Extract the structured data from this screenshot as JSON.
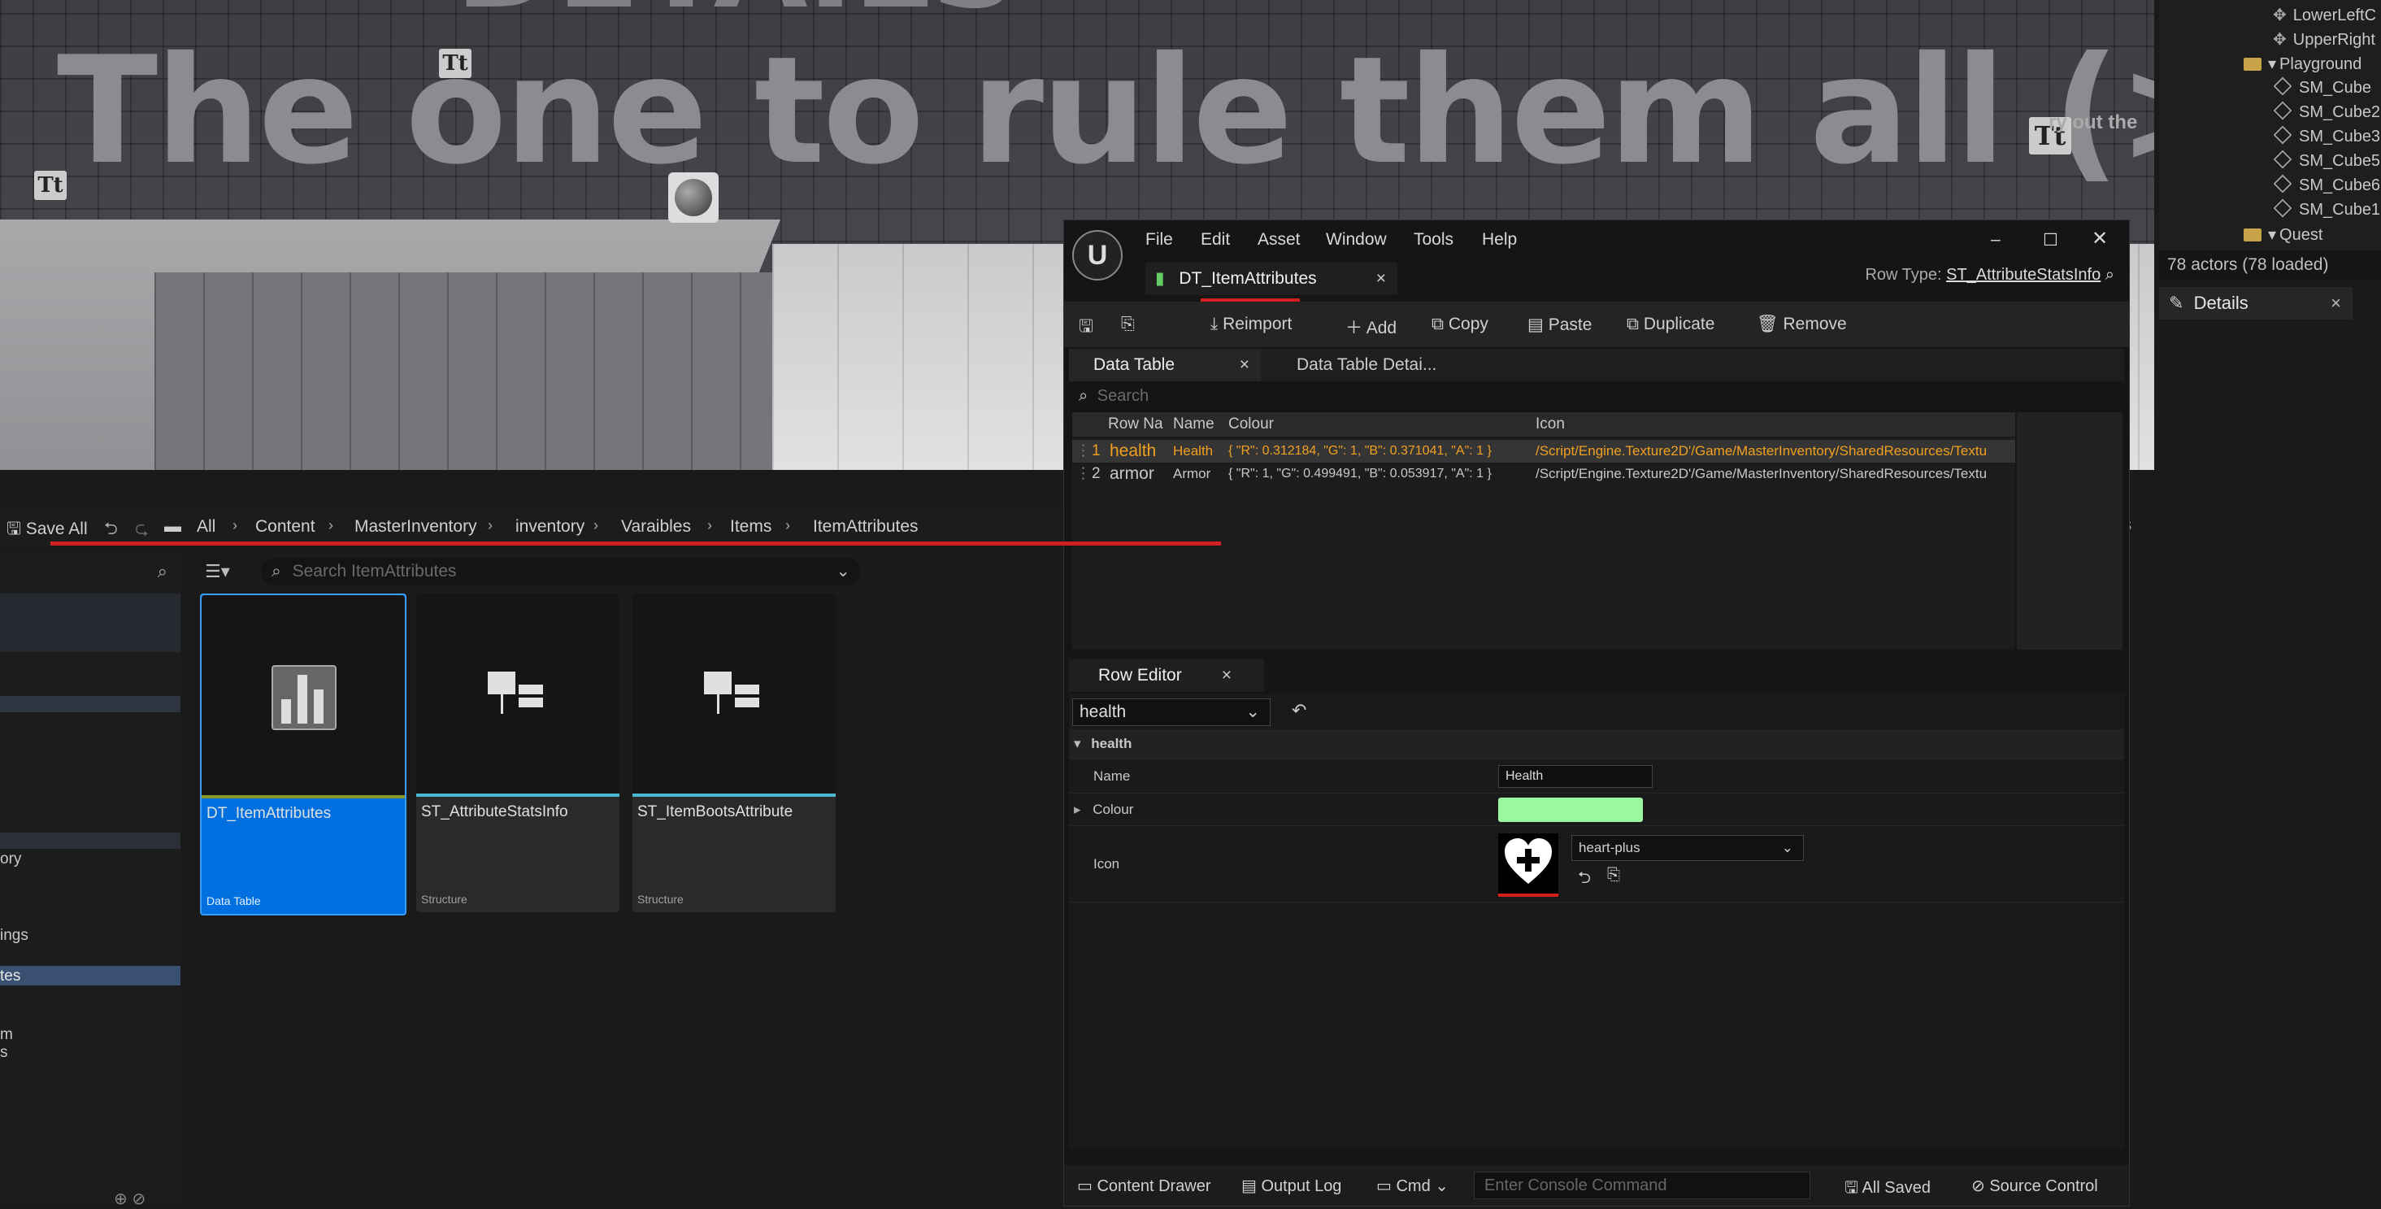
{
  "viewport": {
    "banner": "The one to rule them all (>-<)",
    "banner_top": "DETAILS",
    "tryout": "ry out the",
    "tt_label": "Tt"
  },
  "outliner": {
    "items": [
      {
        "label": "LowerLeftC",
        "kind": "cross"
      },
      {
        "label": "UpperRight",
        "kind": "cross"
      },
      {
        "label": "Playground",
        "kind": "folder"
      },
      {
        "label": "SM_Cube",
        "kind": "cube"
      },
      {
        "label": "SM_Cube2",
        "kind": "cube"
      },
      {
        "label": "SM_Cube3",
        "kind": "cube"
      },
      {
        "label": "SM_Cube5",
        "kind": "cube"
      },
      {
        "label": "SM_Cube6",
        "kind": "cube"
      },
      {
        "label": "SM_Cube1",
        "kind": "cube"
      },
      {
        "label": "Quest",
        "kind": "folder"
      }
    ],
    "actor_count": "78 actors (78 loaded)",
    "details_tab": "Details"
  },
  "content_browser": {
    "save_all": "Save All",
    "breadcrumbs": [
      "All",
      "Content",
      "MasterInventory",
      "inventory",
      "Varaibles",
      "Items",
      "ItemAttributes"
    ],
    "search_placeholder": "Search ItemAttributes",
    "tree_fragments": [
      "ory",
      "ings",
      "tes",
      "m",
      "s"
    ],
    "settings_fragment": "gs",
    "assets": [
      {
        "name": "DT_ItemAttributes",
        "type": "Data Table",
        "selected": true
      },
      {
        "name": "ST_AttributeStatsInfo",
        "type": "Structure",
        "selected": false
      },
      {
        "name": "ST_ItemBootsAttribute",
        "type": "Structure",
        "selected": false
      }
    ]
  },
  "data_table_editor": {
    "menu": [
      "File",
      "Edit",
      "Asset",
      "Window",
      "Tools",
      "Help"
    ],
    "doc_tab": "DT_ItemAttributes",
    "row_type_label": "Row Type:",
    "row_type_value": "ST_AttributeStatsInfo",
    "toolbar": {
      "reimport": "Reimport",
      "add": "Add",
      "copy": "Copy",
      "paste": "Paste",
      "duplicate": "Duplicate",
      "remove": "Remove"
    },
    "tabs": {
      "data_table": "Data Table",
      "details": "Data Table Detai..."
    },
    "search_placeholder": "Search",
    "columns": [
      "Row Na",
      "Name",
      "Colour",
      "Icon"
    ],
    "rows": [
      {
        "index": "1",
        "row_name": "health",
        "name": "Health",
        "colour": "{ \"R\": 0.312184, \"G\": 1, \"B\": 0.371041, \"A\": 1 }",
        "icon": "/Script/Engine.Texture2D'/Game/MasterInventory/SharedResources/Textu",
        "selected": true
      },
      {
        "index": "2",
        "row_name": "armor",
        "name": "Armor",
        "colour": "{ \"R\": 1, \"G\": 0.499491, \"B\": 0.053917, \"A\": 1 }",
        "icon": "/Script/Engine.Texture2D'/Game/MasterInventory/SharedResources/Textu",
        "selected": false
      }
    ],
    "row_editor": {
      "tab": "Row Editor",
      "selected_row": "health",
      "section": "health",
      "props": {
        "name_label": "Name",
        "name_value": "Health",
        "colour_label": "Colour",
        "icon_label": "Icon",
        "icon_value": "heart-plus"
      },
      "colour_hex": "#9cf8a0"
    },
    "statusbar": {
      "content_drawer": "Content Drawer",
      "output_log": "Output Log",
      "cmd": "Cmd",
      "console_placeholder": "Enter Console Command",
      "all_saved": "All Saved",
      "source_control": "Source Control"
    }
  },
  "colors": {
    "accent": "#0070e0",
    "selected_row_text": "#f0a020",
    "highlight_line": "#d21f1f"
  }
}
